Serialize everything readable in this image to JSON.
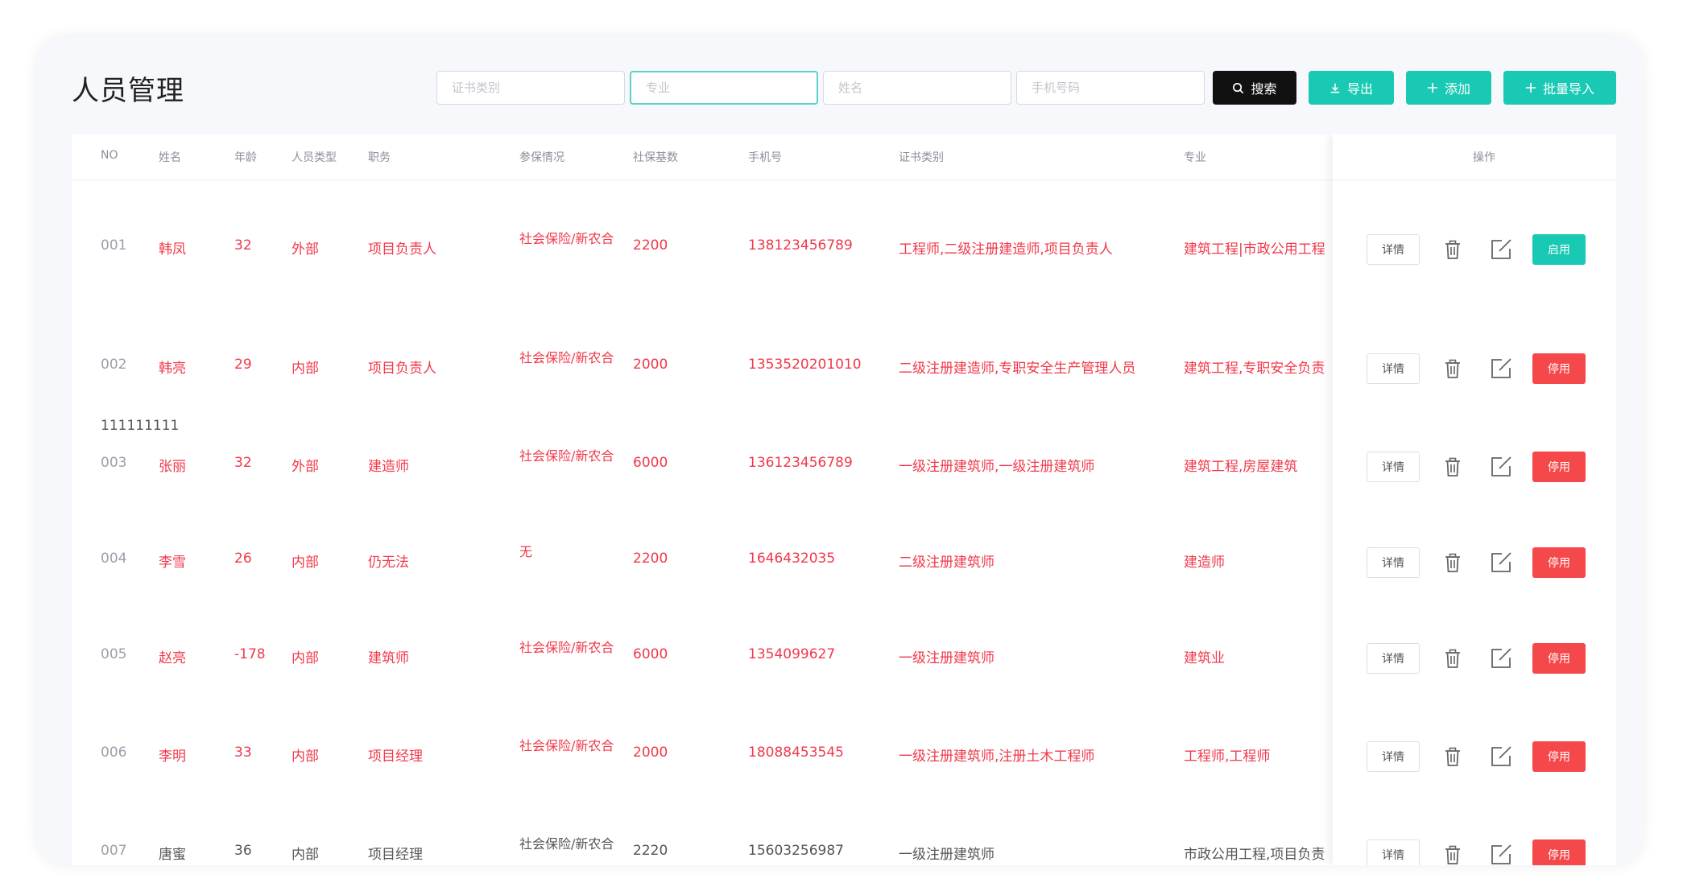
{
  "page": {
    "title": "人员管理"
  },
  "filters": {
    "cert_type_placeholder": "证书类别",
    "major_placeholder": "专业",
    "name_placeholder": "姓名",
    "phone_placeholder": "手机号码"
  },
  "toolbar": {
    "search_label": "搜索",
    "export_label": "导出",
    "add_label": "添加",
    "batch_import_label": "批量导入"
  },
  "table": {
    "headers": {
      "no": "NO",
      "name": "姓名",
      "age": "年龄",
      "type": "人员类型",
      "position": "职务",
      "insurance": "参保情况",
      "base": "社保基数",
      "phone": "手机号",
      "cert": "证书类别",
      "major": "专业",
      "ops": "操作"
    },
    "extra_line": "111111111",
    "rows": [
      {
        "no": "001",
        "name": "韩凤",
        "age": "32",
        "type": "外部",
        "position": "项目负责人",
        "insurance": "社会保险/新农合",
        "base": "2200",
        "phone": "138123456789",
        "cert": "工程师,二级注册建造师,项目负责人",
        "major": "建筑工程|市政公用工程,公",
        "detail": "详情",
        "toggle": "启用",
        "toggle_color": "#19c9b3",
        "red": true
      },
      {
        "no": "002",
        "name": "韩亮",
        "age": "29",
        "type": "内部",
        "position": "项目负责人",
        "insurance": "社会保险/新农合",
        "base": "2000",
        "phone": "1353520201010",
        "cert": "二级注册建造师,专职安全生产管理人员",
        "major": "建筑工程,专职安全负责人",
        "detail": "详情",
        "toggle": "停用",
        "toggle_color": "#f5484b",
        "red": true
      },
      {
        "no": "003",
        "name": "张丽",
        "age": "32",
        "type": "外部",
        "position": "建造师",
        "insurance": "社会保险/新农合",
        "base": "6000",
        "phone": "136123456789",
        "cert": "一级注册建筑师,一级注册建筑师",
        "major": "建筑工程,房屋建筑",
        "detail": "详情",
        "toggle": "停用",
        "toggle_color": "#f5484b",
        "red": true
      },
      {
        "no": "004",
        "name": "李雪",
        "age": "26",
        "type": "内部",
        "position": "仍无法",
        "insurance": "无",
        "base": "2200",
        "phone": "1646432035",
        "cert": "二级注册建筑师",
        "major": "建造师",
        "detail": "详情",
        "toggle": "停用",
        "toggle_color": "#f5484b",
        "red": true
      },
      {
        "no": "005",
        "name": "赵亮",
        "age": "-178",
        "type": "内部",
        "position": "建筑师",
        "insurance": "社会保险/新农合",
        "base": "6000",
        "phone": "1354099627",
        "cert": "一级注册建筑师",
        "major": "建筑业",
        "detail": "详情",
        "toggle": "停用",
        "toggle_color": "#f5484b",
        "red": true
      },
      {
        "no": "006",
        "name": "李明",
        "age": "33",
        "type": "内部",
        "position": "项目经理",
        "insurance": "社会保险/新农合",
        "base": "2000",
        "phone": "18088453545",
        "cert": "一级注册建筑师,注册土木工程师",
        "major": "工程师,工程师",
        "detail": "详情",
        "toggle": "停用",
        "toggle_color": "#f5484b",
        "red": true
      },
      {
        "no": "007",
        "name": "唐蜜",
        "age": "36",
        "type": "内部",
        "position": "项目经理",
        "insurance": "社会保险/新农合",
        "base": "2220",
        "phone": "15603256987",
        "cert": "一级注册建筑师",
        "major": "市政公用工程,项目负责人",
        "detail": "详情",
        "toggle": "停用",
        "toggle_color": "#f5484b",
        "red": false
      }
    ]
  },
  "colors": {
    "accent": "#19c9b3",
    "danger": "#f5484b",
    "highlight_text": "#f0394a"
  }
}
